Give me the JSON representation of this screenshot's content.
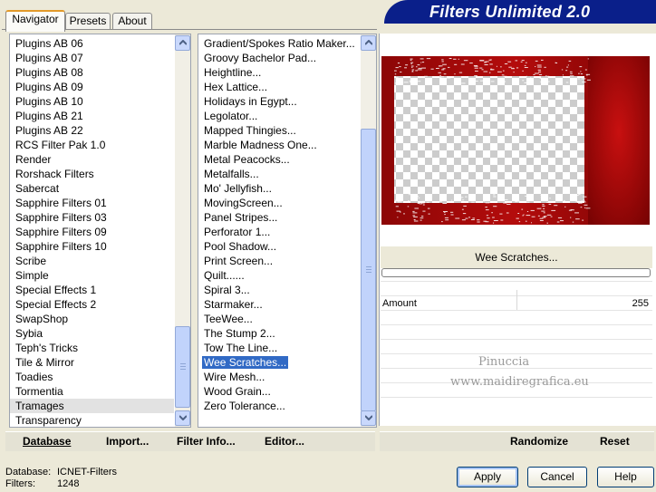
{
  "tabs": [
    {
      "label": "Navigator",
      "active": true
    },
    {
      "label": "Presets",
      "active": false
    },
    {
      "label": "About",
      "active": false
    }
  ],
  "banner": {
    "title": "Filters Unlimited 2.0"
  },
  "categories": {
    "items": [
      "Plugins AB 06",
      "Plugins AB 07",
      "Plugins AB 08",
      "Plugins AB 09",
      "Plugins AB 10",
      "Plugins AB 21",
      "Plugins AB 22",
      "RCS Filter Pak 1.0",
      "Render",
      "Rorshack Filters",
      "Sabercat",
      "Sapphire Filters 01",
      "Sapphire Filters 03",
      "Sapphire Filters 09",
      "Sapphire Filters 10",
      "Scribe",
      "Simple",
      "Special Effects 1",
      "Special Effects 2",
      "SwapShop",
      "Sybia",
      "Teph's Tricks",
      "Tile & Mirror",
      "Toadies",
      "Tormentia",
      "Tramages",
      "Transparency"
    ],
    "selected": "Tramages"
  },
  "filters": {
    "items": [
      "Gradient/Spokes Ratio Maker...",
      "Groovy Bachelor Pad...",
      "Heightline...",
      "Hex Lattice...",
      "Holidays in Egypt...",
      "Legolator...",
      "Mapped Thingies...",
      "Marble Madness One...",
      "Metal Peacocks...",
      "Metalfalls...",
      "Mo' Jellyfish...",
      "MovingScreen...",
      "Panel Stripes...",
      "Perforator 1...",
      "Pool Shadow...",
      "Print Screen...",
      "Quilt......",
      "Spiral 3...",
      "Starmaker...",
      "TeeWee...",
      "The Stump 2...",
      "Tow The Line...",
      "Wee Scratches...",
      "Wire Mesh...",
      "Wood Grain...",
      "Zero Tolerance..."
    ],
    "selected": "Wee Scratches..."
  },
  "filter_name": "Wee Scratches...",
  "params": [
    {
      "label": "Amount",
      "value": "255"
    }
  ],
  "watermark": {
    "line1": "Pinuccia",
    "line2": "www.maidiregrafica.eu"
  },
  "left_buttons": {
    "database": "Database",
    "import": "Import...",
    "filter_info": "Filter Info...",
    "editor": "Editor..."
  },
  "right_buttons": {
    "randomize": "Randomize",
    "reset": "Reset"
  },
  "status": {
    "db_label": "Database:",
    "db_value": "ICNET-Filters",
    "filters_label": "Filters:",
    "filters_value": "1248"
  },
  "dialog_buttons": {
    "apply": "Apply",
    "cancel": "Cancel",
    "help": "Help"
  },
  "colors": {
    "accent": "#316ac5",
    "banner": "#0a1f8a",
    "preview_red": "#a80808"
  }
}
